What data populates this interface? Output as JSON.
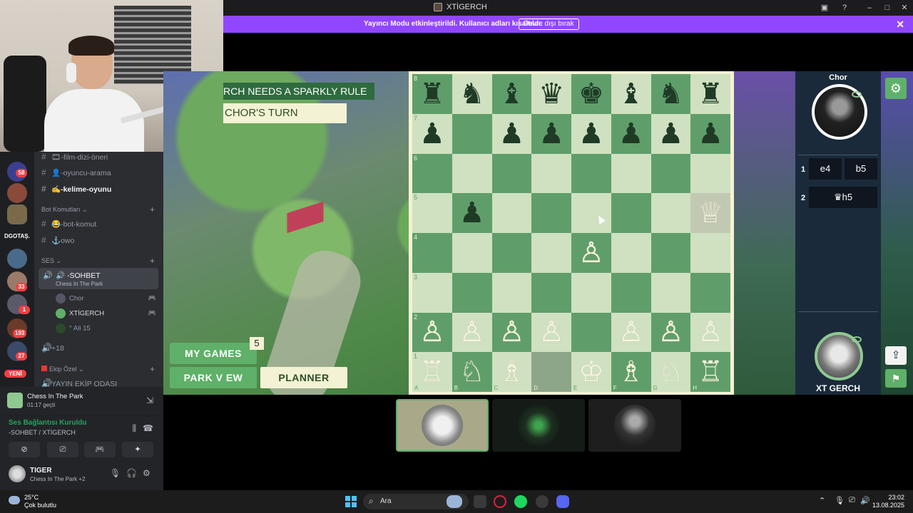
{
  "window": {
    "title": "XTİGERCH"
  },
  "streamer_banner": {
    "message": "Yayıncı Modu etkinleştirildi. Kullanıcı adları kısaltıldı.",
    "disable_label": "Devre dışı bırak"
  },
  "game": {
    "rule_banner": "RCH NEEDS A SPARKLY RULE",
    "turn_banner": "CHOR'S TURN",
    "buttons": {
      "my_games": "MY GAMES",
      "my_games_badge": "5",
      "park_view": "PARK V EW",
      "planner": "PLANNER"
    },
    "board": {
      "ranks": [
        "8",
        "7",
        "6",
        "5",
        "4",
        "3",
        "2",
        "1"
      ],
      "files": [
        "A",
        "B",
        "C",
        "D",
        "E",
        "F",
        "G",
        "H"
      ],
      "rows": [
        [
          "♜",
          "♞",
          "♝",
          "♛",
          "♚",
          "♝",
          "♞",
          "♜"
        ],
        [
          "♟",
          "",
          "♟",
          "♟",
          "♟",
          "♟",
          "♟",
          "♟"
        ],
        [
          "",
          "",
          "",
          "",
          "",
          "",
          "",
          ""
        ],
        [
          "",
          "♟",
          "",
          "",
          "",
          "",
          "",
          "♕"
        ],
        [
          "",
          "",
          "",
          "",
          "♙",
          "",
          "",
          ""
        ],
        [
          "",
          "",
          "",
          "",
          "",
          "",
          "",
          ""
        ],
        [
          "♙",
          "♙",
          "♙",
          "♙",
          "",
          "♙",
          "♙",
          "♙"
        ],
        [
          "♖",
          "♘",
          "♗",
          "",
          "♔",
          "♗",
          "♘",
          "♖"
        ]
      ]
    },
    "players": {
      "top": "Chor",
      "bottom": "XT GERCH"
    },
    "moves": [
      {
        "num": "1",
        "white": "e4",
        "black": "b5"
      },
      {
        "num": "2",
        "white": "♛h5",
        "black": ""
      }
    ]
  },
  "discord": {
    "channels": [
      {
        "name": "🎞-film-dizi-öneri",
        "bold": false
      },
      {
        "name": "👤-oyuncu-arama",
        "bold": false
      },
      {
        "name": "✍-kelime-oyunu",
        "bold": true
      }
    ],
    "category_bot": "Bot Komutları ⌄",
    "bot_channels": [
      {
        "name": "😂-bot-komut"
      },
      {
        "name": "⚓owo"
      }
    ],
    "category_voice": "SES ⌄",
    "voice_channel": {
      "title": "🔊 -SOHBET",
      "subtitle": "Chess In The Park"
    },
    "voice_users": [
      {
        "name": "Chor"
      },
      {
        "name": "XTİGERCH"
      },
      {
        "name": "° Ali 15"
      }
    ],
    "more_users": "+18",
    "category_team": "Ekip Özel ⌄",
    "team_channel": "YAYIN EKİP ODASI",
    "guild_badges": [
      "58",
      "33",
      "1",
      "193",
      "27"
    ],
    "guild_label": "DGOTAŞ.",
    "yeni": "YENİ",
    "activity": {
      "title": "Chess In The Park",
      "time": "01:17 geçti"
    },
    "voice_status": "Ses Bağlantısı Kuruldu",
    "voice_location": "-SOHBET / XTİGERCH",
    "user": {
      "name": "TIGER",
      "activity": "Chess In The Park +2"
    }
  },
  "taskbar": {
    "temperature": "25°C",
    "weather": "Çok bulutlu",
    "search_placeholder": "Ara",
    "time": "23:02",
    "date": "13.08.2025"
  },
  "colors": {
    "accent": "#9146ff",
    "board_dark": "#5f9e6a",
    "board_light": "#cfe1c0",
    "game_green": "#5fb068",
    "discord_green": "#23a55a"
  }
}
